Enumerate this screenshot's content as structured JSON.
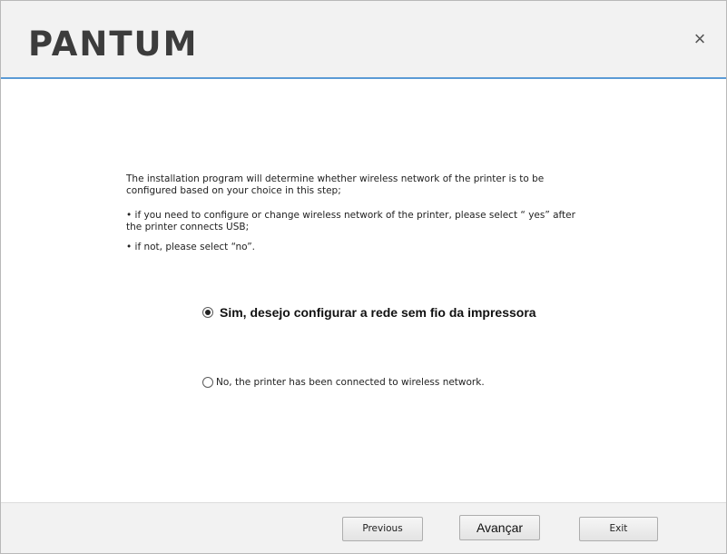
{
  "header": {
    "logo_text": "PANTUM",
    "close_glyph": "×"
  },
  "content": {
    "paragraph1": "The installation program will determine whether wireless network of the printer is to be configured based on your choice in this step;",
    "paragraph2": "• if you need to configure or change wireless network of the printer, please select “ yes” after the printer connects USB;",
    "paragraph3": "• if not, please select “no”."
  },
  "options": [
    {
      "label": "Sim, desejo configurar a rede sem fio da impressora",
      "selected": true
    },
    {
      "label": "No, the printer has been connected to wireless network.",
      "selected": false
    }
  ],
  "footer": {
    "previous_label": "Previous",
    "next_label": "Avançar",
    "exit_label": "Exit"
  },
  "colors": {
    "header_bg": "#f2f2f2",
    "accent_line": "#5b9bd5",
    "logo": "#3c3c3c"
  }
}
